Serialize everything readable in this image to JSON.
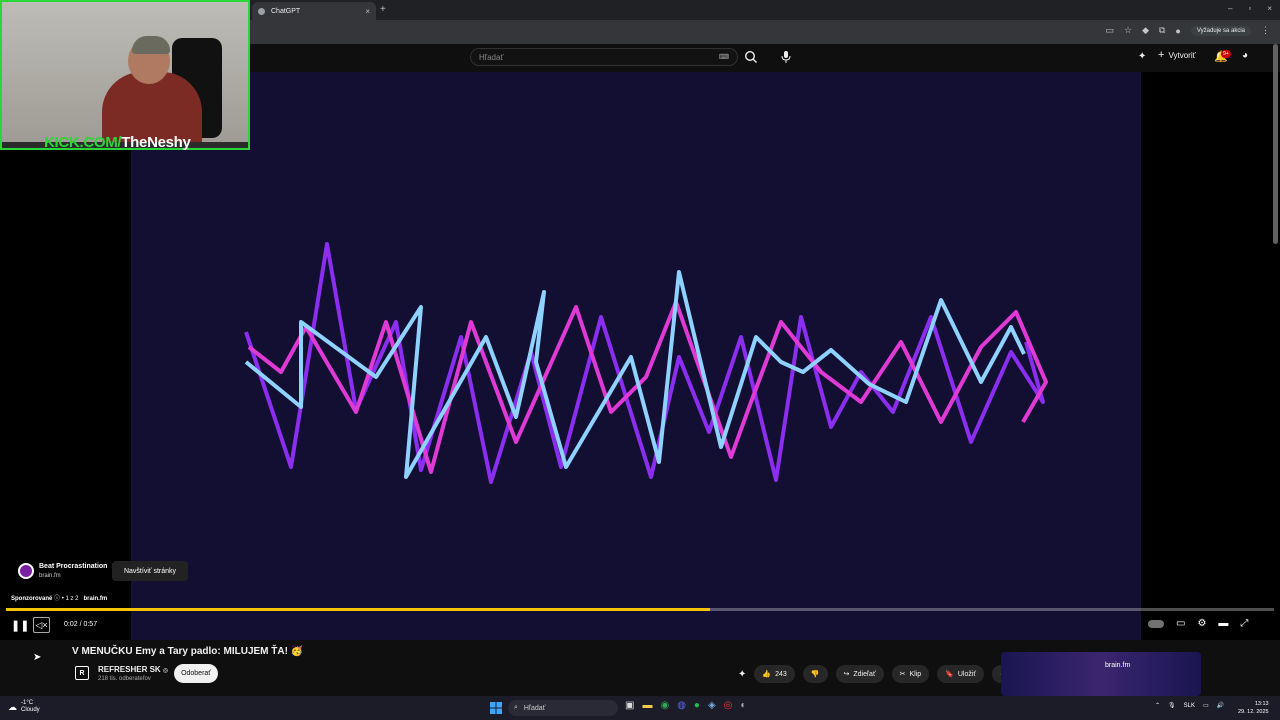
{
  "browser": {
    "tab_title": "ChatGPT",
    "tab_close": "×",
    "new_tab": "+",
    "win_min": "–",
    "win_max": "▫",
    "win_close": "×",
    "signin_label": "Vyžaduje sa akcia"
  },
  "youtube": {
    "search_placeholder": "Hľadať",
    "keyboard_icon": "⌨",
    "mic_icon": "🎤",
    "create_label": "Vytvoriť",
    "notifications_badge": "9+"
  },
  "overlay": {
    "kick_prefix": "KICK.COM/",
    "kick_name": "TheNeshy"
  },
  "ad": {
    "title": "Beat Procrastination",
    "domain": "brain.fm",
    "visit_label": "Navštíviť stránky",
    "sponsored": "Sponzorované",
    "sponsored_count": "1 z 2",
    "sponsored_domain": "brain.fm"
  },
  "player": {
    "time": "0:02 / 0:57",
    "progress": 0.555,
    "accent_color": "#f7c300"
  },
  "video": {
    "title": "V MENUČKU Emy a Tary padlo: MILUJEM ŤA! 🥳",
    "channel_name": "REFRESHER SK",
    "channel_verified": "◎",
    "subscribers": "218 tis. odberateľov",
    "subscribe_label": "Odoberať",
    "like_count": "243",
    "share_label": "Zdieľať",
    "clip_label": "Klip",
    "save_label": "Uložiť",
    "more_label": "···"
  },
  "sidebar_ad": {
    "brand": "brain.fm"
  },
  "taskbar": {
    "temperature": "-1°C",
    "weather": "Cloudy",
    "search_placeholder": "Hľadať",
    "language": "SLK",
    "time": "13:13",
    "date": "29. 12. 2025"
  }
}
